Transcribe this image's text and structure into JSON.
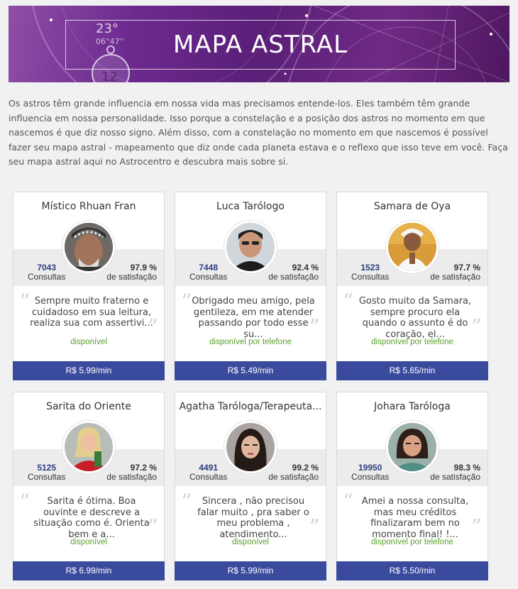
{
  "banner": {
    "title": "MAPA ASTRAL",
    "deco_texts": [
      "23°",
      "06°47''",
      "12"
    ]
  },
  "intro": "Os astros têm grande influencia em nossa vida mas precisamos entende-los. Eles também têm grande influencia em nossa personalidade. Isso porque a constelação e a posição dos astros no momento em que nascemos é que diz nosso signo. Além disso, com a constelação no momento em que nascemos é possível fazer seu mapa astral - mapeamento que diz onde cada planeta estava e o reflexo que isso teve em você. Faça seu mapa astral aqui no Astrocentro e descubra mais sobre si.",
  "labels": {
    "consultas": "Consultas",
    "satisfacao": "de satisfação"
  },
  "colors": {
    "price_bar": "#3a4b9e",
    "available": "#5aa02c",
    "count": "#2c3e7f",
    "banner": "#6c2a8f"
  },
  "cards": [
    {
      "name": "Místico Rhuan Fran",
      "consultas": "7043",
      "satisfacao": "97.9 %",
      "testimonial": "Sempre muito fraterno e cuidadoso em sua leitura, realiza sua com assertivi...",
      "status": "disponível",
      "price": "R$ 5.99/min",
      "avatar": "rhuan-avatar"
    },
    {
      "name": "Luca Tarólogo",
      "consultas": "7448",
      "satisfacao": "92.4 %",
      "testimonial": "Obrigado meu amigo, pela gentileza, em me atender passando por todo esse su...",
      "status": "disponível por telefone",
      "price": "R$ 5.49/min",
      "avatar": "luca-avatar"
    },
    {
      "name": "Samara de Oya",
      "consultas": "1523",
      "satisfacao": "97.7 %",
      "testimonial": "Gosto muito da Samara, sempre procuro ela quando o assunto é do coração, el...",
      "status": "disponível por telefone",
      "price": "R$ 5.65/min",
      "avatar": "samara-avatar"
    },
    {
      "name": "Sarita do Oriente",
      "consultas": "5125",
      "satisfacao": "97.2 %",
      "testimonial": "Sarita é ótima. Boa ouvinte e descreve a situação como é. Orienta bem e a...",
      "status": "disponível",
      "price": "R$ 6.99/min",
      "avatar": "sarita-avatar"
    },
    {
      "name": "Agatha Taróloga/Terapeuta...",
      "consultas": "4491",
      "satisfacao": "99.2 %",
      "testimonial": "Sincera , não precisou falar muito , pra saber o meu problema , atendimento...",
      "status": "disponível",
      "price": "R$ 5.99/min",
      "avatar": "agatha-avatar"
    },
    {
      "name": "Johara Taróloga",
      "consultas": "19950",
      "satisfacao": "98.3 %",
      "testimonial": "Amei a nossa consulta, mas meu créditos finalizaram bem no momento final! !...",
      "status": "disponível por telefone",
      "price": "R$ 5.50/min",
      "avatar": "johara-avatar"
    }
  ]
}
